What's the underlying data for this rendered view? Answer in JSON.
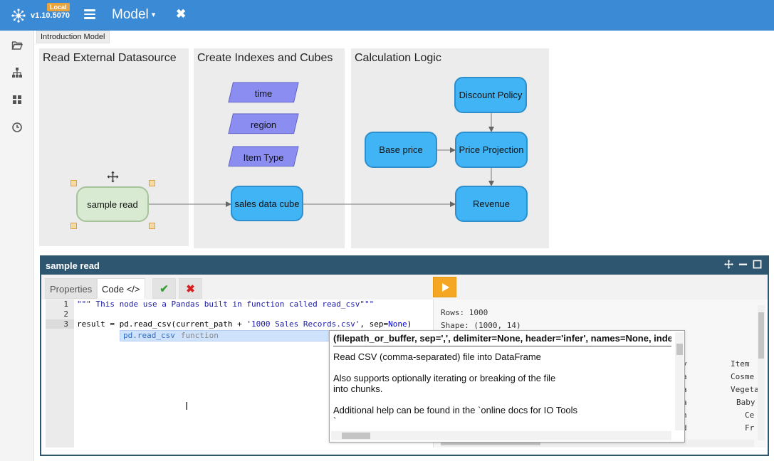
{
  "app": {
    "version": "v1.10.5070",
    "env_badge": "Local",
    "model_name": "Model",
    "model_caret": "▾",
    "close_symbol": "✖",
    "accent": "#3a8ad6"
  },
  "sidebar": {
    "items": [
      {
        "icon": "folder-open-icon"
      },
      {
        "icon": "sitemap-icon"
      },
      {
        "icon": "dashboard-icon"
      },
      {
        "icon": "clock-icon"
      }
    ]
  },
  "diagram": {
    "tab_label": "Introduction Model",
    "groups": [
      {
        "title": "Read External Datasource"
      },
      {
        "title": "Create Indexes and Cubes"
      },
      {
        "title": "Calculation Logic"
      }
    ],
    "nodes": {
      "time": "time",
      "region": "region",
      "item_type": "Item Type",
      "sample_read": "sample read",
      "sales_cube": "sales data cube",
      "discount_policy": "Discount Policy",
      "base_price": "Base price",
      "price_projection": "Price Projection",
      "revenue": "Revenue"
    },
    "colors": {
      "node_blue": "#40b4f4",
      "index_purple": "#8b8ef0",
      "datasource_green": "#d9ead3"
    }
  },
  "panel": {
    "title": "sample read",
    "tabs": {
      "properties": "Properties",
      "code": "Code </>"
    },
    "confirm_symbol": "✔",
    "cancel_symbol": "✖",
    "editor": {
      "line_numbers": [
        "1",
        "2",
        "3"
      ],
      "line1": "\"\"\" This node use a Pandas built in function called read_csv\"\"\"",
      "line3_a": "result = pd.read_csv(current_path + ",
      "line3_str": "'1000 Sales Records.csv'",
      "line3_b": ", sep=",
      "line3_kw": "None",
      "line3_c": ")",
      "autocomplete_name": "pd.read_csv",
      "autocomplete_kind": "function",
      "cursor_glyph": "I"
    },
    "output": {
      "rows": "Rows: 1000",
      "shape": "Shape: (1000, 14)",
      "col_left": [
        "y",
        "a",
        "a",
        "a",
        "n",
        "d"
      ],
      "col_right": [
        "Item",
        "Cosme",
        "Vegeta",
        "Baby",
        "Ce",
        "Fr"
      ]
    }
  },
  "tooltip": {
    "signature": "(filepath_or_buffer, sep=',', delimiter=None, header='infer', names=None, index_col=None",
    "line1": "Read CSV (comma-separated) file into DataFrame",
    "line2": "Also supports optionally iterating or breaking of the file",
    "line3": "into chunks.",
    "line4": "Additional help can be found in the `online docs for IO Tools",
    "line5": "`_."
  }
}
